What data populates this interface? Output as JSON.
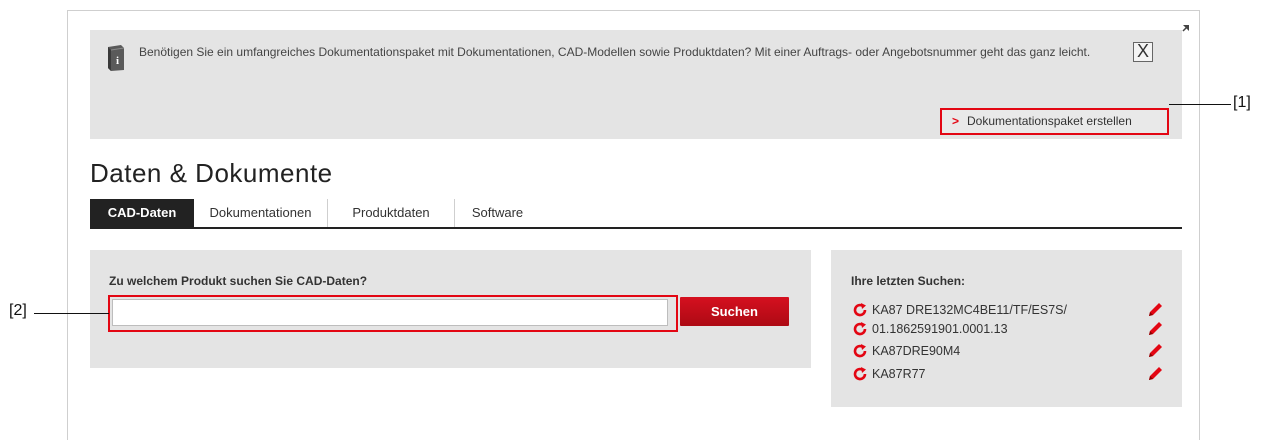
{
  "info": {
    "text": "Benötigen Sie ein umfangreiches Dokumentationspaket mit Dokumentationen, CAD-Modellen sowie Produktdaten? Mit einer Auftrags- oder Angebotsnummer geht das ganz leicht.",
    "close_label": "X",
    "link_label": "Dokumentationspaket erstellen"
  },
  "callouts": {
    "one": "[1]",
    "two": "[2]"
  },
  "page": {
    "title": "Daten & Dokumente"
  },
  "tabs": [
    {
      "label": "CAD-Daten",
      "active": true
    },
    {
      "label": "Dokumentationen",
      "active": false
    },
    {
      "label": "Produktdaten",
      "active": false
    },
    {
      "label": "Software",
      "active": false
    }
  ],
  "search": {
    "question": "Zu welchem Produkt suchen Sie CAD-Daten?",
    "value": "",
    "placeholder": "",
    "button_label": "Suchen"
  },
  "recent": {
    "title": "Ihre letzten Suchen:",
    "items": [
      "KA87 DRE132MC4BE11/TF/ES7S/",
      "01.1862591901.0001.13",
      "KA87DRE90M4",
      "KA87R77"
    ]
  },
  "colors": {
    "accent": "#e30613",
    "panel": "#e4e4e4",
    "tab_active": "#222222"
  },
  "icons": {
    "info": "info-book-icon",
    "close": "close-icon",
    "expand": "expand-icon",
    "chevron": "chevron-right-icon",
    "reload": "reload-icon",
    "edit": "pencil-icon"
  }
}
